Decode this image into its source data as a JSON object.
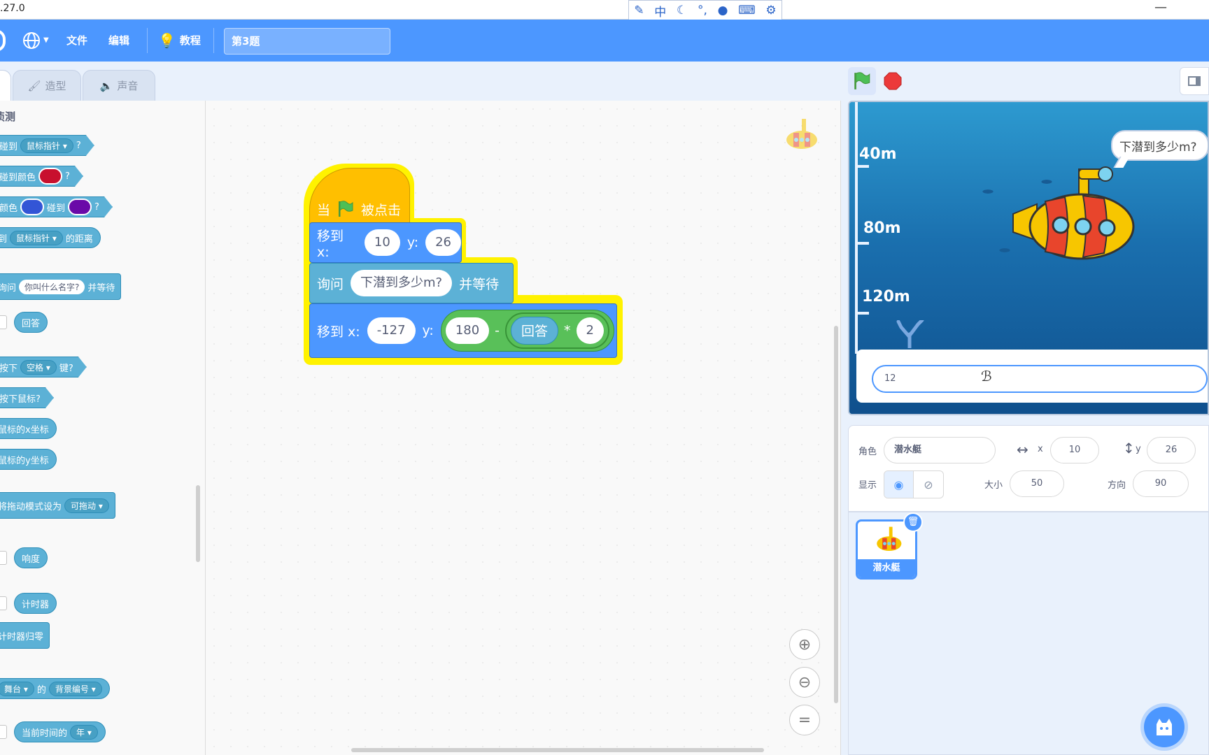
{
  "window": {
    "version_fragment": ".27.0",
    "minimize": "—"
  },
  "ime": {
    "icons": [
      "pencil-box-icon",
      "zh-icon",
      "moon-icon",
      "punct-icon",
      "user-icon",
      "keyboard-icon",
      "gear-icon"
    ],
    "zh_label": "中"
  },
  "menu": {
    "file": "文件",
    "edit": "编辑",
    "tutorials": "教程",
    "project_title": "第3题"
  },
  "tabs": {
    "costumes": "造型",
    "sounds": "声音"
  },
  "palette": {
    "category": "侦测",
    "blocks": {
      "touching": "碰到",
      "mouse_pointer": "鼠标指针",
      "q": "?",
      "touching_color": "碰到颜色",
      "color": "颜色",
      "touching2": "碰到",
      "distance_to": "到",
      "distance_suffix": "的距离",
      "ask": "询问",
      "ask_default": "你叫什么名字?",
      "and_wait": "并等待",
      "answer": "回答",
      "key_pressed_prefix": "按下",
      "key_space": "空格",
      "key_pressed_suffix": "键?",
      "mouse_down": "按下鼠标?",
      "mouse_x": "鼠标的x坐标",
      "mouse_y": "鼠标的y坐标",
      "set_drag_mode": "将拖动模式设为",
      "draggable": "可拖动",
      "loudness": "响度",
      "timer": "计时器",
      "reset_timer": "计时器归零",
      "stage": "舞台",
      "of": "的",
      "backdrop_number": "背景编号",
      "current_time": "当前时间的",
      "year": "年"
    },
    "colors": {
      "red": "#c8102e",
      "blue": "#3355d6",
      "purple": "#6a0aa8"
    }
  },
  "script": {
    "hat_when": "当",
    "hat_clicked": "被点击",
    "goto1_label": "移到 x:",
    "goto1_x": "10",
    "y_label": "y:",
    "goto1_y": "26",
    "ask_label": "询问",
    "ask_text": "下潜到多少m?",
    "ask_wait": "并等待",
    "goto2_label": "移到 x:",
    "goto2_x": "-127",
    "goto2_y_label": "y:",
    "op_left": "180",
    "op_minus": "-",
    "op_answer": "回答",
    "op_times": "*",
    "op_right": "2"
  },
  "stage": {
    "depth_40": "40m",
    "depth_80": "80m",
    "depth_120": "120m",
    "bubble": "下潜到多少m?",
    "answer_input": "12"
  },
  "sprite_info": {
    "sprite_label": "角色",
    "sprite_name": "潜水艇",
    "x_label": "x",
    "x_value": "10",
    "y_label": "y",
    "y_value": "26",
    "show_label": "显示",
    "size_label": "大小",
    "size_value": "50",
    "direction_label": "方向",
    "direction_value": "90"
  },
  "sprite_list": {
    "items": [
      {
        "name": "潜水艇"
      }
    ]
  },
  "colors": {
    "menu_blue": "#4c97ff",
    "motion_blue": "#4c97ff",
    "events_yellow": "#ffbf00",
    "sensing": "#5cb1d6",
    "operators_green": "#59c059",
    "glow": "#fff200"
  }
}
